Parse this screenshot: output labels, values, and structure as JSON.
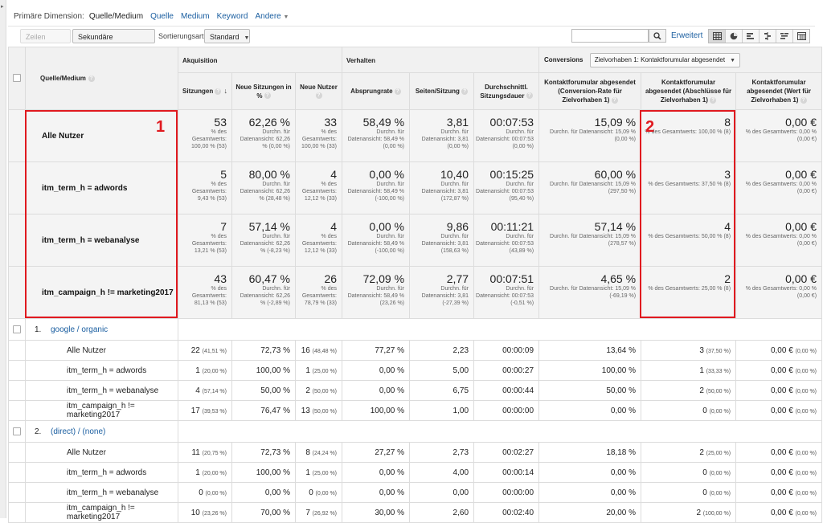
{
  "dimension_bar": {
    "label": "Primäre Dimension:",
    "current": "Quelle/Medium",
    "links": [
      "Quelle",
      "Medium",
      "Keyword",
      "Andere"
    ]
  },
  "toolbar": {
    "show_rows": "Zeilen darstellen",
    "secondary_dimension": "Sekundäre Dimension",
    "sort_label": "Sortierungsart:",
    "sort_value": "Standard",
    "search_value": "",
    "advanced": "Erweitert",
    "view_icons": [
      "table-view-icon",
      "pie-view-icon",
      "performance-view-icon",
      "comparison-view-icon",
      "term-cloud-view-icon",
      "pivot-view-icon"
    ]
  },
  "header": {
    "dimension": "Quelle/Medium",
    "sections": {
      "acquisition": "Akquisition",
      "behavior": "Verhalten",
      "conversions": "Conversions",
      "goal_select": "Zielvorhaben 1: Kontaktforumular abgesendet"
    },
    "columns": [
      "Sitzungen",
      "Neue Sitzungen in %",
      "Neue Nutzer",
      "Absprungrate",
      "Seiten/Sitzung",
      "Durchschnittl. Sitzungsdauer",
      "Kontaktforumular abgesendet (Conversion-Rate für Zielvorhaben 1)",
      "Kontaktforumular abgesendet (Abschlüsse für Zielvorhaben 1)",
      "Kontaktforumular abgesendet (Wert für Zielvorhaben 1)"
    ]
  },
  "summary_rows": [
    {
      "label": "Alle Nutzer",
      "cells": [
        {
          "v": "53",
          "s": "% des Gesamtwerts: 100,00 % (53)"
        },
        {
          "v": "62,26 %",
          "s": "Durchn. für Datenansicht: 62,26 % (0,00 %)"
        },
        {
          "v": "33",
          "s": "% des Gesamtwerts: 100,00 % (33)"
        },
        {
          "v": "58,49 %",
          "s": "Durchn. für Datenansicht: 58,49 % (0,00 %)"
        },
        {
          "v": "3,81",
          "s": "Durchn. für Datenansicht: 3,81 (0,00 %)"
        },
        {
          "v": "00:07:53",
          "s": "Durchn. für Datenansicht: 00:07:53 (0,00 %)"
        },
        {
          "v": "15,09 %",
          "s": "Durchn. für Datenansicht: 15,09 % (0,00 %)"
        },
        {
          "v": "8",
          "s": "% des Gesamtwerts: 100,00 % (8)"
        },
        {
          "v": "0,00 €",
          "s": "% des Gesamtwerts: 0,00 % (0,00 €)"
        }
      ]
    },
    {
      "label": "itm_term_h = adwords",
      "cells": [
        {
          "v": "5",
          "s": "% des Gesamtwerts: 9,43 % (53)"
        },
        {
          "v": "80,00 %",
          "s": "Durchn. für Datenansicht: 62,26 % (28,48 %)"
        },
        {
          "v": "4",
          "s": "% des Gesamtwerts: 12,12 % (33)"
        },
        {
          "v": "0,00 %",
          "s": "Durchn. für Datenansicht: 58,49 % (-100,00 %)"
        },
        {
          "v": "10,40",
          "s": "Durchn. für Datenansicht: 3,81 (172,87 %)"
        },
        {
          "v": "00:15:25",
          "s": "Durchn. für Datenansicht: 00:07:53 (95,40 %)"
        },
        {
          "v": "60,00 %",
          "s": "Durchn. für Datenansicht: 15,09 % (297,50 %)"
        },
        {
          "v": "3",
          "s": "% des Gesamtwerts: 37,50 % (8)"
        },
        {
          "v": "0,00 €",
          "s": "% des Gesamtwerts: 0,00 % (0,00 €)"
        }
      ]
    },
    {
      "label": "itm_term_h = webanalyse",
      "cells": [
        {
          "v": "7",
          "s": "% des Gesamtwerts: 13,21 % (53)"
        },
        {
          "v": "57,14 %",
          "s": "Durchn. für Datenansicht: 62,26 % (-8,23 %)"
        },
        {
          "v": "4",
          "s": "% des Gesamtwerts: 12,12 % (33)"
        },
        {
          "v": "0,00 %",
          "s": "Durchn. für Datenansicht: 58,49 % (-100,00 %)"
        },
        {
          "v": "9,86",
          "s": "Durchn. für Datenansicht: 3,81 (158,63 %)"
        },
        {
          "v": "00:11:21",
          "s": "Durchn. für Datenansicht: 00:07:53 (43,89 %)"
        },
        {
          "v": "57,14 %",
          "s": "Durchn. für Datenansicht: 15,09 % (278,57 %)"
        },
        {
          "v": "4",
          "s": "% des Gesamtwerts: 50,00 % (8)"
        },
        {
          "v": "0,00 €",
          "s": "% des Gesamtwerts: 0,00 % (0,00 €)"
        }
      ]
    },
    {
      "label": "itm_campaign_h != marketing2017",
      "cells": [
        {
          "v": "43",
          "s": "% des Gesamtwerts: 81,13 % (53)"
        },
        {
          "v": "60,47 %",
          "s": "Durchn. für Datenansicht: 62,26 % (-2,89 %)"
        },
        {
          "v": "26",
          "s": "% des Gesamtwerts: 78,79 % (33)"
        },
        {
          "v": "72,09 %",
          "s": "Durchn. für Datenansicht: 58,49 % (23,26 %)"
        },
        {
          "v": "2,77",
          "s": "Durchn. für Datenansicht: 3,81 (-27,39 %)"
        },
        {
          "v": "00:07:51",
          "s": "Durchn. für Datenansicht: 00:07:53 (-0,51 %)"
        },
        {
          "v": "4,65 %",
          "s": "Durchn. für Datenansicht: 15,09 % (-69,19 %)"
        },
        {
          "v": "2",
          "s": "% des Gesamtwerts: 25,00 % (8)"
        },
        {
          "v": "0,00 €",
          "s": "% des Gesamtwerts: 0,00 % (0,00 €)"
        }
      ]
    }
  ],
  "groups": [
    {
      "num": "1.",
      "name": "google / organic",
      "rows": [
        {
          "label": "Alle Nutzer",
          "cells": [
            [
              "22",
              "(41,51 %)"
            ],
            [
              "72,73 %",
              ""
            ],
            [
              "16",
              "(48,48 %)"
            ],
            [
              "77,27 %",
              ""
            ],
            [
              "2,23",
              ""
            ],
            [
              "00:00:09",
              ""
            ],
            [
              "13,64 %",
              ""
            ],
            [
              "3",
              "(37,50 %)"
            ],
            [
              "0,00 €",
              "(0,00 %)"
            ]
          ]
        },
        {
          "label": "itm_term_h = adwords",
          "cells": [
            [
              "1",
              "(20,00 %)"
            ],
            [
              "100,00 %",
              ""
            ],
            [
              "1",
              "(25,00 %)"
            ],
            [
              "0,00 %",
              ""
            ],
            [
              "5,00",
              ""
            ],
            [
              "00:00:27",
              ""
            ],
            [
              "100,00 %",
              ""
            ],
            [
              "1",
              "(33,33 %)"
            ],
            [
              "0,00 €",
              "(0,00 %)"
            ]
          ]
        },
        {
          "label": "itm_term_h = webanalyse",
          "cells": [
            [
              "4",
              "(57,14 %)"
            ],
            [
              "50,00 %",
              ""
            ],
            [
              "2",
              "(50,00 %)"
            ],
            [
              "0,00 %",
              ""
            ],
            [
              "6,75",
              ""
            ],
            [
              "00:00:44",
              ""
            ],
            [
              "50,00 %",
              ""
            ],
            [
              "2",
              "(50,00 %)"
            ],
            [
              "0,00 €",
              "(0,00 %)"
            ]
          ]
        },
        {
          "label": "itm_campaign_h != marketing2017",
          "cells": [
            [
              "17",
              "(39,53 %)"
            ],
            [
              "76,47 %",
              ""
            ],
            [
              "13",
              "(50,00 %)"
            ],
            [
              "100,00 %",
              ""
            ],
            [
              "1,00",
              ""
            ],
            [
              "00:00:00",
              ""
            ],
            [
              "0,00 %",
              ""
            ],
            [
              "0",
              "(0,00 %)"
            ],
            [
              "0,00 €",
              "(0,00 %)"
            ]
          ]
        }
      ]
    },
    {
      "num": "2.",
      "name": "(direct) / (none)",
      "rows": [
        {
          "label": "Alle Nutzer",
          "cells": [
            [
              "11",
              "(20,75 %)"
            ],
            [
              "72,73 %",
              ""
            ],
            [
              "8",
              "(24,24 %)"
            ],
            [
              "27,27 %",
              ""
            ],
            [
              "2,73",
              ""
            ],
            [
              "00:02:27",
              ""
            ],
            [
              "18,18 %",
              ""
            ],
            [
              "2",
              "(25,00 %)"
            ],
            [
              "0,00 €",
              "(0,00 %)"
            ]
          ]
        },
        {
          "label": "itm_term_h = adwords",
          "cells": [
            [
              "1",
              "(20,00 %)"
            ],
            [
              "100,00 %",
              ""
            ],
            [
              "1",
              "(25,00 %)"
            ],
            [
              "0,00 %",
              ""
            ],
            [
              "4,00",
              ""
            ],
            [
              "00:00:14",
              ""
            ],
            [
              "0,00 %",
              ""
            ],
            [
              "0",
              "(0,00 %)"
            ],
            [
              "0,00 €",
              "(0,00 %)"
            ]
          ]
        },
        {
          "label": "itm_term_h = webanalyse",
          "cells": [
            [
              "0",
              "(0,00 %)"
            ],
            [
              "0,00 %",
              ""
            ],
            [
              "0",
              "(0,00 %)"
            ],
            [
              "0,00 %",
              ""
            ],
            [
              "0,00",
              ""
            ],
            [
              "00:00:00",
              ""
            ],
            [
              "0,00 %",
              ""
            ],
            [
              "0",
              "(0,00 %)"
            ],
            [
              "0,00 €",
              "(0,00 %)"
            ]
          ]
        },
        {
          "label": "itm_campaign_h != marketing2017",
          "cells": [
            [
              "10",
              "(23,26 %)"
            ],
            [
              "70,00 %",
              ""
            ],
            [
              "7",
              "(26,92 %)"
            ],
            [
              "30,00 %",
              ""
            ],
            [
              "2,60",
              ""
            ],
            [
              "00:02:40",
              ""
            ],
            [
              "20,00 %",
              ""
            ],
            [
              "2",
              "(100,00 %)"
            ],
            [
              "0,00 €",
              "(0,00 %)"
            ]
          ]
        }
      ]
    }
  ],
  "annotations": {
    "label1": "1",
    "label2": "2",
    "color": "#e0191f"
  },
  "colors": {
    "link": "#1a5ea0",
    "header_bg": "#f1f1f1",
    "summary_bg": "#f4f4f4"
  }
}
